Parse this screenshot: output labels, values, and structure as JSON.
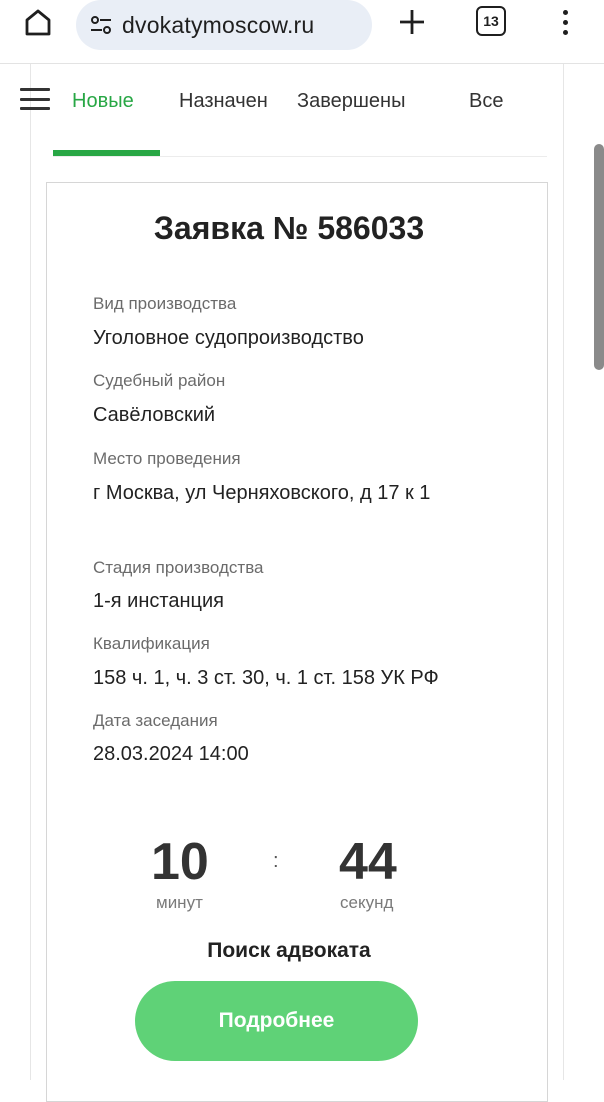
{
  "browser": {
    "url": "dvokatymoscow.ru",
    "tab_count": "13"
  },
  "nav": {
    "tabs": [
      {
        "label": "Новые",
        "active": true
      },
      {
        "label": "Назначен",
        "active": false
      },
      {
        "label": "Завершены",
        "active": false
      },
      {
        "label": "Все",
        "active": false
      }
    ]
  },
  "request": {
    "title": "Заявка № 586033",
    "fields": [
      {
        "label": "Вид производства",
        "value": "Уголовное судопроизводство"
      },
      {
        "label": "Судебный район",
        "value": "Савёловский"
      },
      {
        "label": "Место проведения",
        "value": "г Москва, ул Черняховского, д 17 к 1"
      },
      {
        "label": "Стадия производства",
        "value": "1-я инстанция"
      },
      {
        "label": "Квалификация",
        "value": "158 ч. 1, ч. 3 ст. 30, ч. 1 ст. 158 УК РФ"
      },
      {
        "label": "Дата заседания",
        "value": "28.03.2024 14:00"
      }
    ]
  },
  "timer": {
    "minutes": "10",
    "minutes_label": "минут",
    "separator": ":",
    "seconds": "44",
    "seconds_label": "секунд"
  },
  "status_text": "Поиск адвоката",
  "details_button": "Подробнее",
  "colors": {
    "accent": "#28a745",
    "button": "#5fd277"
  },
  "icons": {
    "home": "home-icon",
    "site_settings": "tune-icon",
    "new_tab": "plus-icon",
    "menu": "more-vert-icon",
    "nav_menu": "hamburger-icon"
  }
}
